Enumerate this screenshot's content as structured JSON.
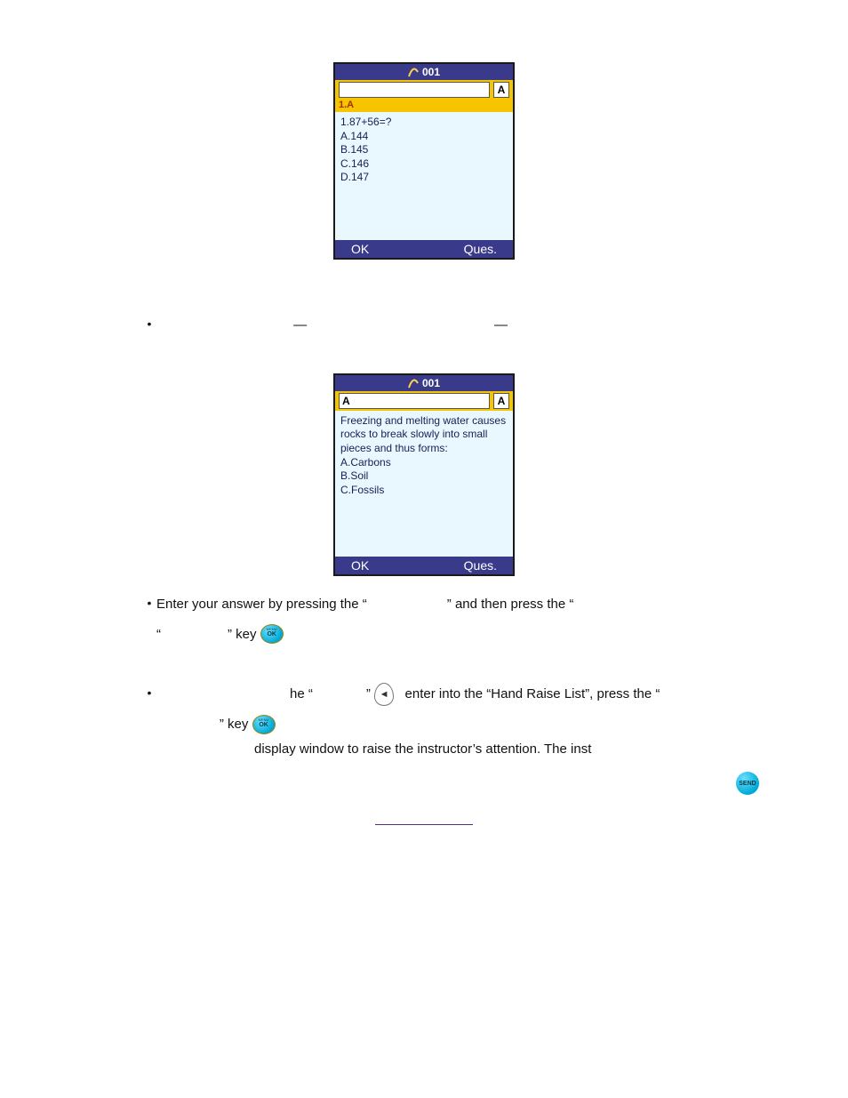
{
  "device1": {
    "header_id": "001",
    "input_value": "",
    "mode_letter": "A",
    "subline": "1.A",
    "question": "1.87+56=?",
    "options": [
      "A.144",
      "B.145",
      "C.146",
      "D.147"
    ],
    "footer_left": "OK",
    "footer_right": "Ques."
  },
  "device2": {
    "header_id": "001",
    "input_value": "A",
    "mode_letter": "A",
    "question": "Freezing and melting water causes rocks to break slowly into small pieces and thus forms:",
    "options": [
      "A.Carbons",
      "B.Soil",
      "C.Fossils"
    ],
    "footer_left": "OK",
    "footer_right": "Ques."
  },
  "text": {
    "bullet1_pre": "—",
    "bullet1_post": "—",
    "bullet2_a": "Enter your answer by pressing the “",
    "bullet2_b": "” and then press the “",
    "bullet2_c": "“",
    "bullet2_d": "” key",
    "bullet3_a": "he “",
    "bullet3_b": "”",
    "bullet3_c": "enter into the “Hand Raise List”, press the “",
    "bullet3_d": "” key",
    "bullet3_e": "display window to raise the instructor’s attention. The inst"
  },
  "keys": {
    "send_label": "SEND",
    "left_arrow": "◄"
  }
}
